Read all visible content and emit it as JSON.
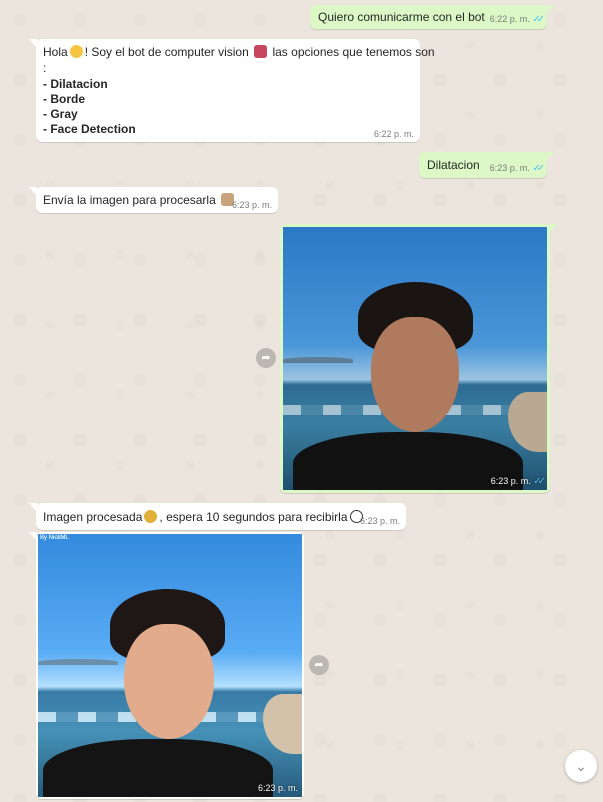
{
  "messages": {
    "m1": {
      "text": "Quiero comunicarme con el bot",
      "time": "6:22 p. m."
    },
    "m2": {
      "line1_a": "Hola",
      "line1_b": "! Soy el bot de computer vision",
      "line1_c": "las opciones que tenemos son",
      "line2": ":",
      "options": [
        "- Dilatacion",
        "- Borde",
        "- Gray",
        "- Face Detection"
      ],
      "time": "6:22 p. m."
    },
    "m3": {
      "text": "Dilatacion",
      "time": "6:23 p. m."
    },
    "m4": {
      "text": "Envía la imagen para procesarla",
      "time": "6:23 p. m."
    },
    "m5": {
      "time": "6:23 p. m."
    },
    "m6": {
      "text_a": "Imagen procesada",
      "text_b": ", espera 10 segundos para recibirla",
      "time": "6:23 p. m."
    },
    "m7": {
      "watermark": "By NickML",
      "time": "6:23 p. m."
    }
  },
  "icons": {
    "double_tick": "✓✓",
    "forward": "➦",
    "chevron_down": "⌄"
  },
  "colors": {
    "outgoing_bubble": "#dcf8c6",
    "incoming_bubble": "#ffffff",
    "read_ticks": "#4fc3f7"
  }
}
